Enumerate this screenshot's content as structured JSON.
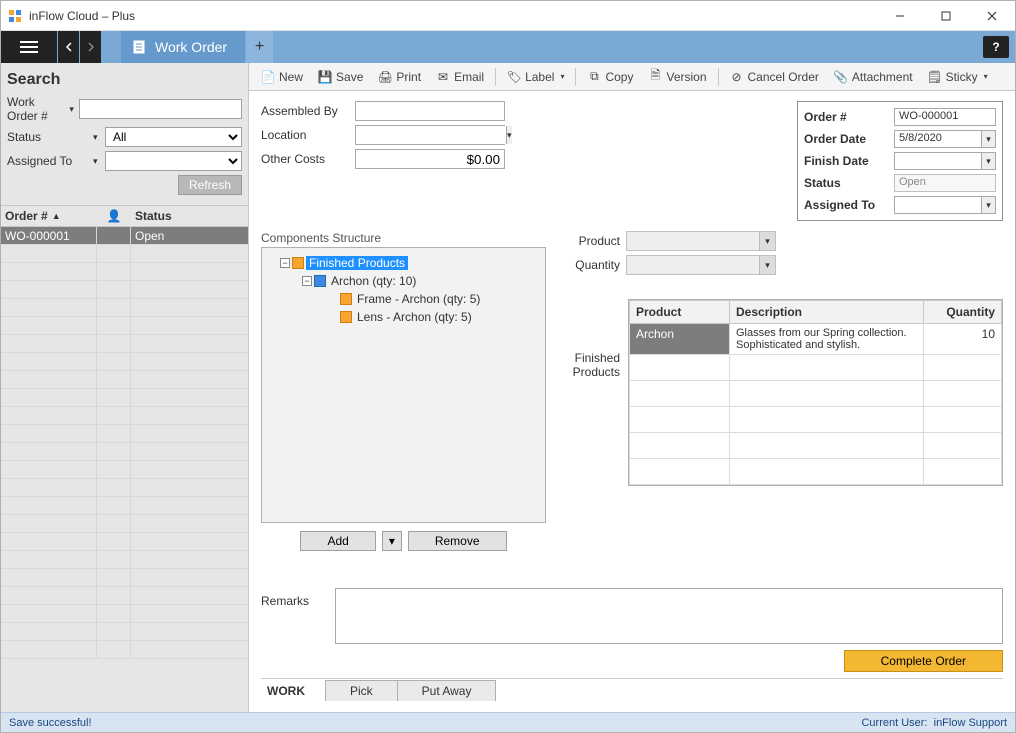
{
  "window": {
    "title": "inFlow Cloud – Plus"
  },
  "tab": {
    "label": "Work Order"
  },
  "toolbar": {
    "new": "New",
    "save": "Save",
    "print": "Print",
    "email": "Email",
    "label": "Label",
    "copy": "Copy",
    "version": "Version",
    "cancel": "Cancel Order",
    "attachment": "Attachment",
    "sticky": "Sticky"
  },
  "sidebar": {
    "heading": "Search",
    "filters": {
      "work_order_label": "Work Order #",
      "work_order_value": "",
      "status_label": "Status",
      "status_value": "All",
      "assigned_label": "Assigned To",
      "assigned_value": ""
    },
    "refresh": "Refresh",
    "columns": {
      "order": "Order #",
      "status": "Status"
    },
    "rows": [
      {
        "order": "WO-000001",
        "status": "Open",
        "selected": true
      }
    ]
  },
  "form": {
    "assembled_by_label": "Assembled By",
    "assembled_by_value": "",
    "location_label": "Location",
    "location_value": "",
    "other_costs_label": "Other Costs",
    "other_costs_value": "$0.00"
  },
  "summary": {
    "order_label": "Order #",
    "order_value": "WO-000001",
    "order_date_label": "Order Date",
    "order_date_value": "5/8/2020",
    "finish_date_label": "Finish Date",
    "finish_date_value": "",
    "status_label": "Status",
    "status_value": "Open",
    "assigned_label": "Assigned To",
    "assigned_value": ""
  },
  "components": {
    "label": "Components Structure",
    "tree": {
      "root": "Finished Products",
      "child": "Archon  (qty: 10)",
      "leaf1": "Frame - Archon  (qty: 5)",
      "leaf2": "Lens - Archon  (qty: 5)"
    },
    "add": "Add",
    "remove": "Remove"
  },
  "product_form": {
    "product_label": "Product",
    "quantity_label": "Quantity",
    "fp_label": "Finished Products",
    "columns": {
      "product": "Product",
      "description": "Description",
      "quantity": "Quantity"
    },
    "rows": [
      {
        "product": "Archon",
        "description": "Glasses from our Spring collection. Sophisticated and stylish.",
        "quantity": "10"
      }
    ]
  },
  "remarks": {
    "label": "Remarks",
    "value": ""
  },
  "complete": "Complete Order",
  "bottom_tabs": {
    "stage": "WORK",
    "pick": "Pick",
    "putaway": "Put Away"
  },
  "statusbar": {
    "message": "Save successful!",
    "user_label": "Current User:",
    "user": "inFlow Support"
  }
}
